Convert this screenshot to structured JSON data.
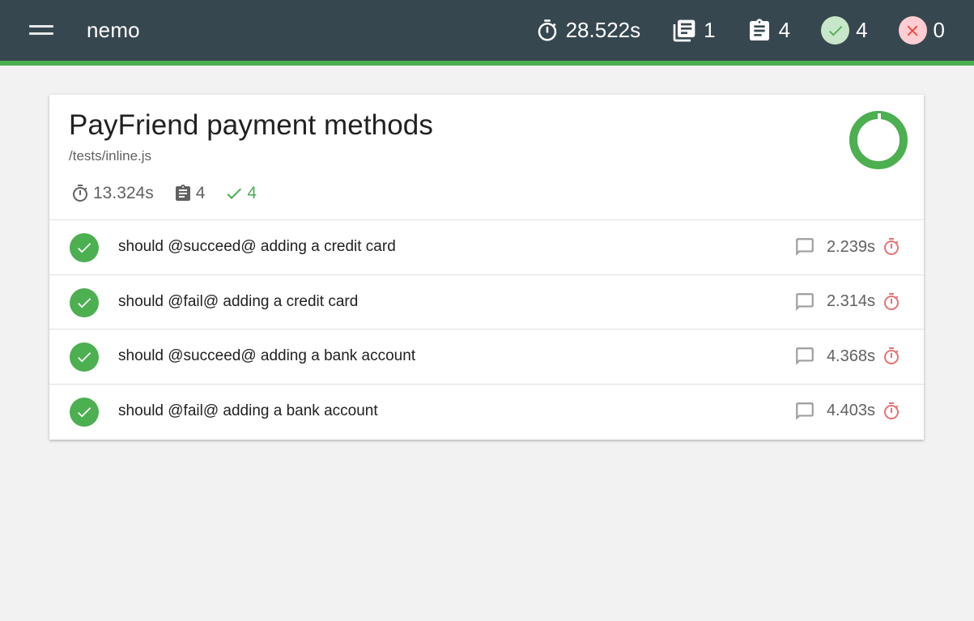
{
  "app": {
    "title": "nemo"
  },
  "stats": {
    "duration": "28.522s",
    "suites": "1",
    "tests": "4",
    "passes": "4",
    "failures": "0"
  },
  "suite": {
    "title": "PayFriend payment methods",
    "file": "/tests/inline.js",
    "duration": "13.324s",
    "tests": "4",
    "passes": "4",
    "pass_fraction": 1.0,
    "tests_list": [
      {
        "title": "should @succeed@ adding a credit card",
        "duration": "2.239s"
      },
      {
        "title": "should @fail@ adding a credit card",
        "duration": "2.314s"
      },
      {
        "title": "should @succeed@ adding a bank account",
        "duration": "4.368s"
      },
      {
        "title": "should @fail@ adding a bank account",
        "duration": "4.403s"
      }
    ]
  },
  "colors": {
    "topbar": "#37474f",
    "accent": "#4caf50",
    "pass_circle": "#c8e6c9",
    "fail_circle": "#ffcdd2",
    "slow_timer": "#e57373"
  },
  "icons": {
    "menu": "hamburger-icon",
    "duration": "stopwatch-icon",
    "suites": "library-books-icon",
    "tests": "clipboard-icon",
    "passes": "check-icon",
    "failures": "close-icon",
    "context": "comment-icon",
    "slow": "timer-icon"
  }
}
